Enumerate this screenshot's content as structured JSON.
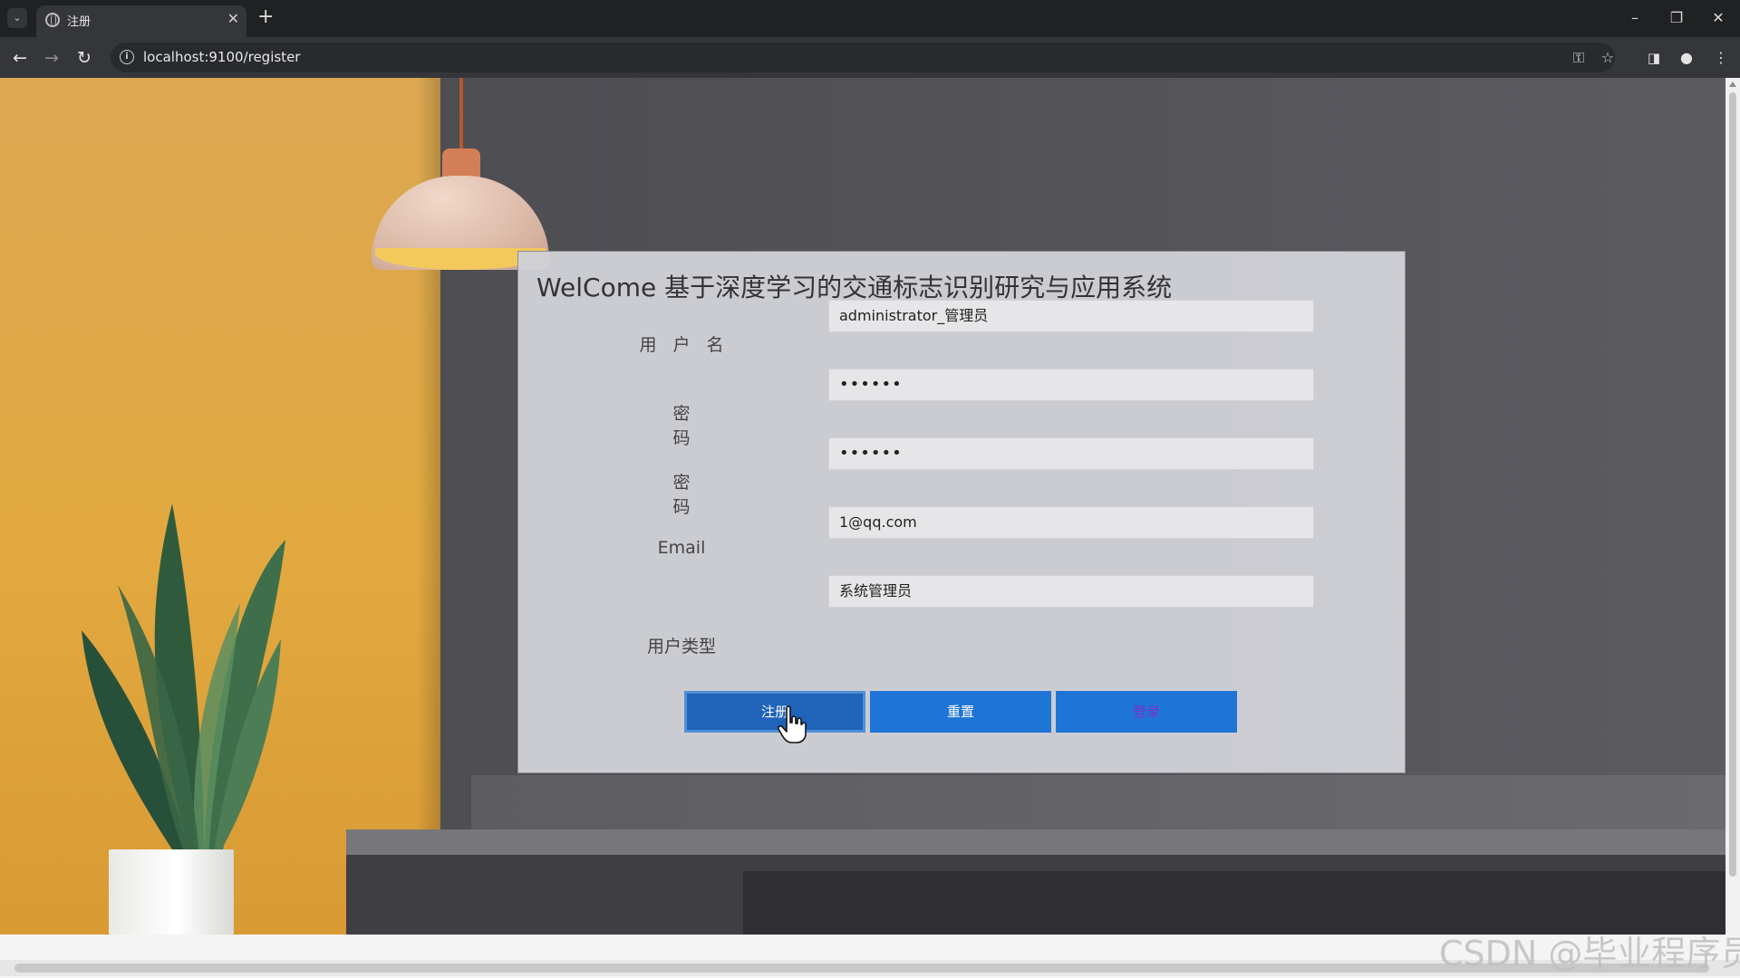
{
  "browser": {
    "tab_title": "注册",
    "tab_close_glyph": "✕",
    "new_tab_glyph": "+",
    "url": "localhost:9100/register"
  },
  "card": {
    "title": "WelCome 基于深度学习的交通标志识别研究与应用系统",
    "labels": {
      "username": "用户名",
      "password": "密码",
      "confirm_password": "密码",
      "email": "Email",
      "user_type": "用户类型"
    },
    "values": {
      "username": "administrator_管理员",
      "password": "••••••",
      "confirm_password": "••••••",
      "email": "1@qq.com",
      "user_type": "系统管理员"
    },
    "buttons": {
      "register": "注册",
      "reset": "重置",
      "login": "登录"
    }
  },
  "watermark": "CSDN @毕业程序员"
}
